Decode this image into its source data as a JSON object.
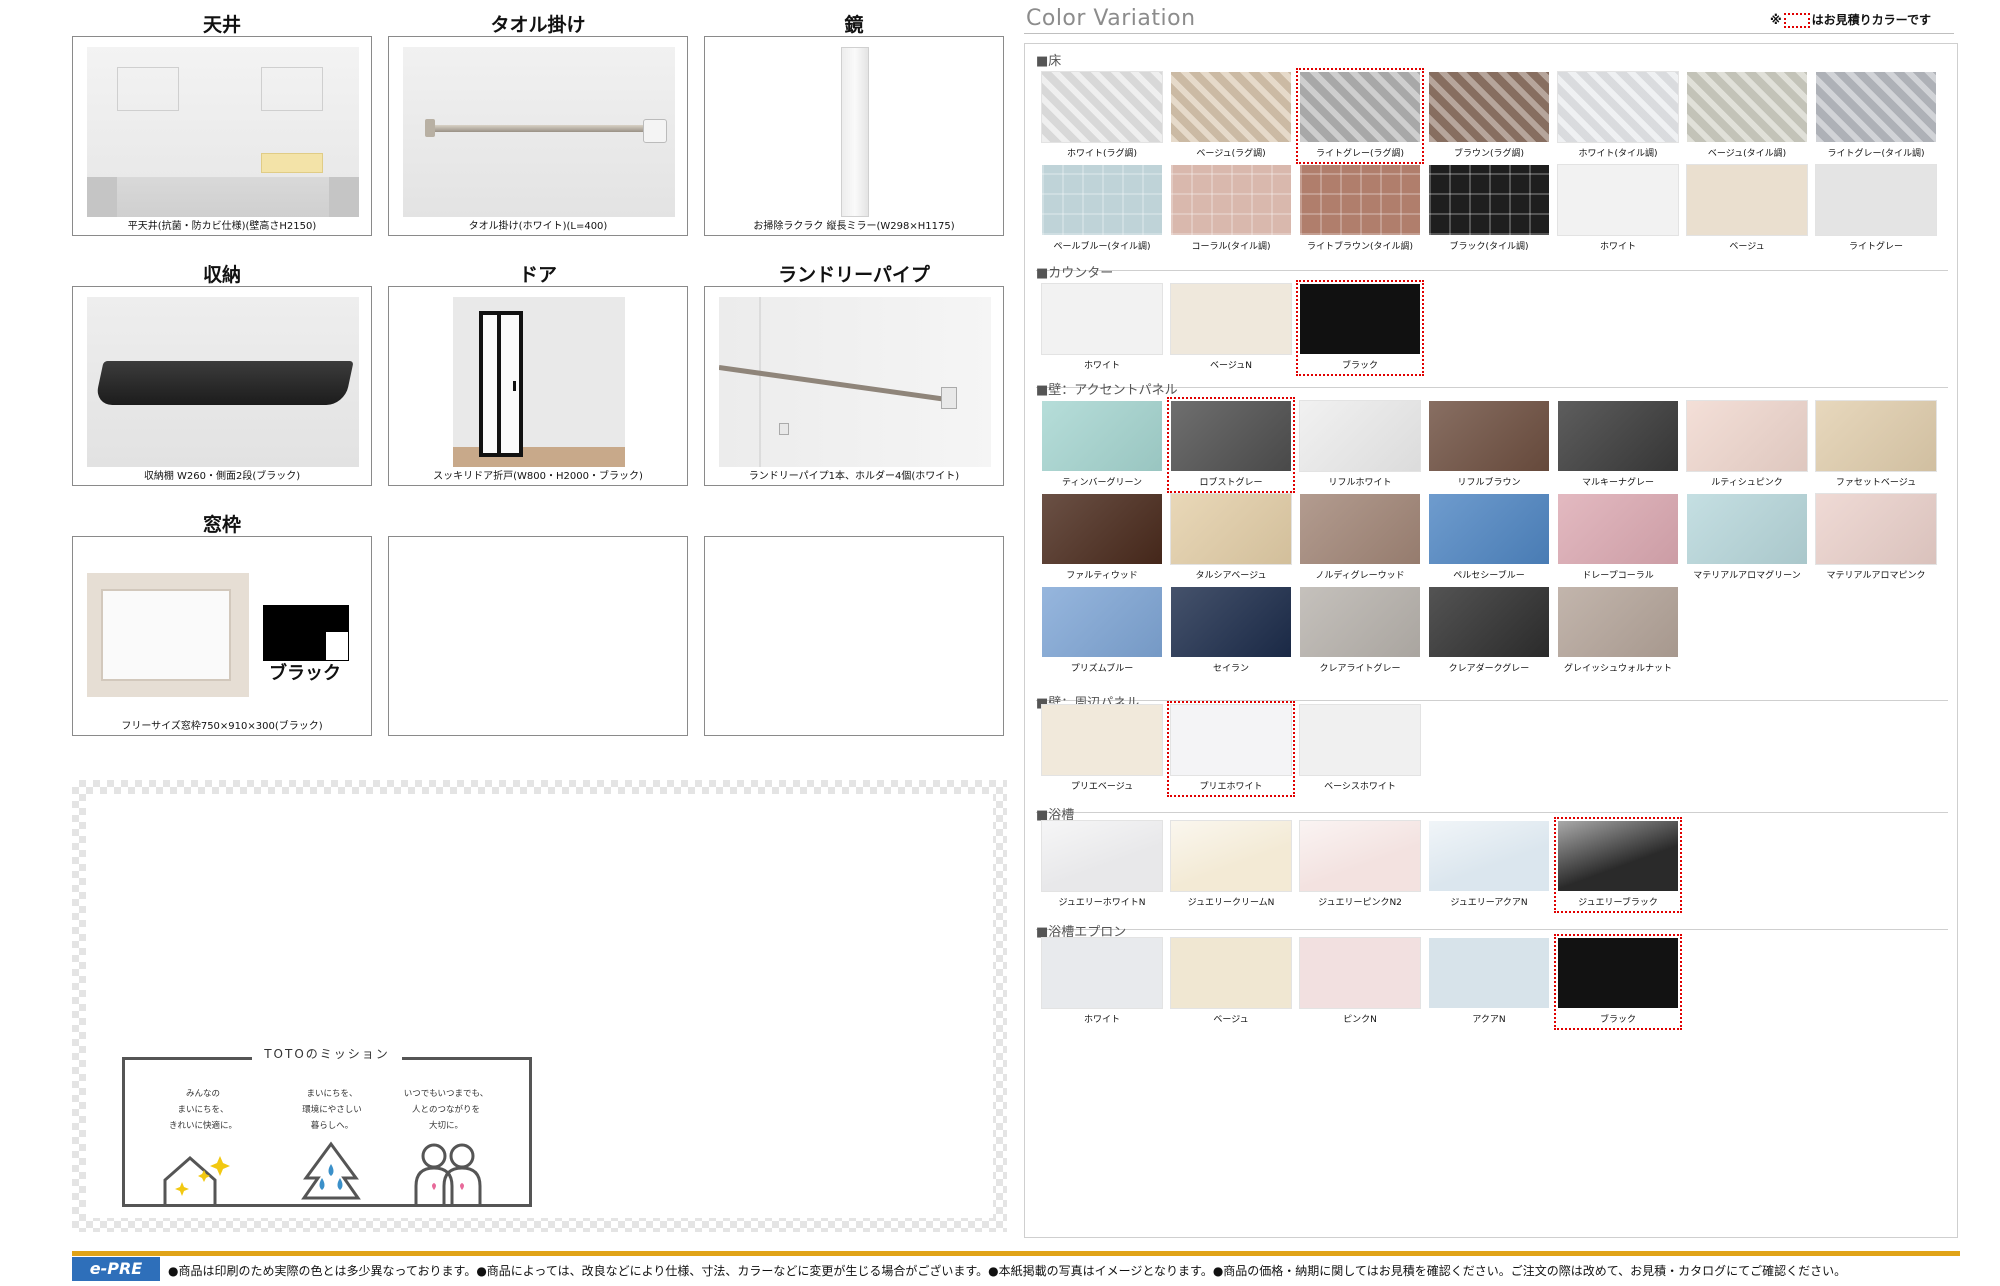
{
  "cards": [
    {
      "title": "天井",
      "caption": "平天井(抗菌・防カビ仕様)(壁高さH2150)"
    },
    {
      "title": "タオル掛け",
      "caption": "タオル掛け(ホワイト)(L=400)"
    },
    {
      "title": "鏡",
      "caption": "お掃除ラクラク 縦長ミラー(W298×H1175)"
    },
    {
      "title": "収納",
      "caption": "収納棚 W260・側面2段(ブラック)"
    },
    {
      "title": "ドア",
      "caption": "スッキリドア折戸(W800・H2000・ブラック)"
    },
    {
      "title": "ランドリーパイプ",
      "caption": "ランドリーパイプ1本、ホルダー4個(ホワイト)"
    },
    {
      "title": "窓枠",
      "caption": "フリーサイズ窓枠750×910×300(ブラック)",
      "inset_label": "ブラック"
    }
  ],
  "mission": {
    "title": "TOTOのミッション",
    "columns": [
      [
        "みんなの",
        "まいにちを、",
        "きれいに快適に。"
      ],
      [
        "まいにちを、",
        "環境にやさしい",
        "暮らしへ。"
      ],
      [
        "いつでもいつまでも、",
        "人とのつながりを",
        "大切に。"
      ]
    ]
  },
  "color_variation": {
    "title": "Color Variation",
    "note_prefix": "※",
    "note_suffix": "はお見積りカラーです",
    "sections": {
      "floor": {
        "label": "■床",
        "swatches": [
          {
            "name": "ホワイト(ラグ調)",
            "color": "#e6e6e6"
          },
          {
            "name": "ベージュ(ラグ調)",
            "color": "#d8c6ae"
          },
          {
            "name": "ライトグレー(ラグ調)",
            "color": "#b3b3b3",
            "estimate": true
          },
          {
            "name": "ブラウン(ラグ調)",
            "color": "#8f7566"
          },
          {
            "name": "ホワイト(タイル調)",
            "color": "#e7e9ec"
          },
          {
            "name": "ベージュ(タイル調)",
            "color": "#cfcfc4"
          },
          {
            "name": "ライトグレー(タイル調)",
            "color": "#b9bcc2"
          },
          {
            "name": "ペールブルー(タイル調)",
            "color": "#bfd3d8"
          },
          {
            "name": "コーラル(タイル調)",
            "color": "#d9b8ad"
          },
          {
            "name": "ライトブラウン(タイル調)",
            "color": "#b07e6c"
          },
          {
            "name": "ブラック(タイル調)",
            "color": "#1e1e1e"
          },
          {
            "name": "ホワイト",
            "color": "#f2f2f2"
          },
          {
            "name": "ベージュ",
            "color": "#eadfcf"
          },
          {
            "name": "ライトグレー",
            "color": "#e4e4e4"
          }
        ]
      },
      "counter": {
        "label": "■カウンター",
        "swatches": [
          {
            "name": "ホワイト",
            "color": "#f2f2f2"
          },
          {
            "name": "ベージュN",
            "color": "#efe8dc"
          },
          {
            "name": "ブラック",
            "color": "#111111",
            "estimate": true
          }
        ]
      },
      "accent": {
        "label": "■壁：アクセントパネル",
        "swatches": [
          {
            "name": "ティンバーグリーン",
            "color": "#a6d6d1"
          },
          {
            "name": "ロブストグレー",
            "color": "#4f4f4f",
            "estimate": true
          },
          {
            "name": "リフルホワイト",
            "color": "#eeeeee"
          },
          {
            "name": "リフルブラウン",
            "color": "#6e4f40"
          },
          {
            "name": "マルキーナグレー",
            "color": "#3a3a3a"
          },
          {
            "name": "ルティシュピンク",
            "color": "#f1d8cf"
          },
          {
            "name": "ファセットベージュ",
            "color": "#e2cfae"
          },
          {
            "name": "ファルティウッド",
            "color": "#4a2a1c"
          },
          {
            "name": "タルシアベージュ",
            "color": "#e4cfa8"
          },
          {
            "name": "ノルディグレーウッド",
            "color": "#a28677"
          },
          {
            "name": "ペルセシーブルー",
            "color": "#4f86c3"
          },
          {
            "name": "ドレープコーラル",
            "color": "#ddaab3"
          },
          {
            "name": "マテリアルアロマグリーン",
            "color": "#b8d8dc"
          },
          {
            "name": "マテリアルアロマピンク",
            "color": "#ecd2cc"
          },
          {
            "name": "プリズムブルー",
            "color": "#7fa6d6"
          },
          {
            "name": "セイラン",
            "color": "#1c2c4b"
          },
          {
            "name": "クレアライトグレー",
            "color": "#b8b3ad"
          },
          {
            "name": "クレアダークグレー",
            "color": "#2e2e2e"
          },
          {
            "name": "グレイッシュウォルナット",
            "color": "#b5a59a"
          }
        ]
      },
      "surround": {
        "label": "■壁：周辺パネル",
        "swatches": [
          {
            "name": "プリエベージュ",
            "color": "#f1e9db"
          },
          {
            "name": "プリエホワイト",
            "color": "#f4f4f6",
            "estimate": true
          },
          {
            "name": "ベーシスホワイト",
            "color": "#f0f0f0"
          }
        ]
      },
      "bathtub": {
        "label": "■浴槽",
        "swatches": [
          {
            "name": "ジュエリーホワイトN",
            "color": "#e8e8ea"
          },
          {
            "name": "ジュエリークリームN",
            "color": "#f3ead5"
          },
          {
            "name": "ジュエリーピンクN2",
            "color": "#f3e2e0"
          },
          {
            "name": "ジュエリーアクアN",
            "color": "#dbe6ee"
          },
          {
            "name": "ジュエリーブラック",
            "color": "#2a2a2a",
            "estimate": true
          }
        ]
      },
      "apron": {
        "label": "■浴槽エプロン",
        "swatches": [
          {
            "name": "ホワイト",
            "color": "#e8eaed"
          },
          {
            "name": "ベージュ",
            "color": "#f0e7d2"
          },
          {
            "name": "ピンクN",
            "color": "#f2e0e0"
          },
          {
            "name": "アクアN",
            "color": "#d7e3ea"
          },
          {
            "name": "ブラック",
            "color": "#121212",
            "estimate": true
          }
        ]
      }
    }
  },
  "footer": {
    "logo": "e-PRE",
    "text": "●商品は印刷のため実際の色とは多少異なっております。●商品によっては、改良などにより仕様、寸法、カラーなどに変更が生じる場合がございます。●本紙掲載の写真はイメージとなります。●商品の価格・納期に関してはお見積を確認ください。ご注文の際は改めて、お見積・カタログにてご確認ください。"
  }
}
